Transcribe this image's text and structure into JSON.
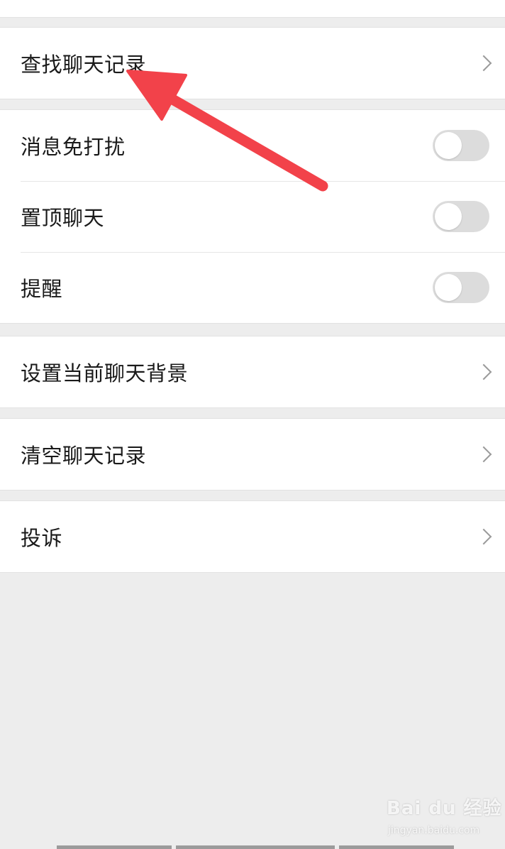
{
  "settings": {
    "search_history": {
      "label": "查找聊天记录"
    },
    "mute": {
      "label": "消息免打扰",
      "enabled": false
    },
    "pin": {
      "label": "置顶聊天",
      "enabled": false
    },
    "remind": {
      "label": "提醒",
      "enabled": false
    },
    "chat_background": {
      "label": "设置当前聊天背景"
    },
    "clear_history": {
      "label": "清空聊天记录"
    },
    "complain": {
      "label": "投诉"
    }
  },
  "annotation": {
    "arrow_color": "#f2424a"
  },
  "watermark": {
    "logo_text": "Bai du 经验",
    "url": "jingyan.baidu.com"
  },
  "colors": {
    "background": "#ededed",
    "row_background": "#ffffff",
    "toggle_off": "#dcdcdc"
  }
}
